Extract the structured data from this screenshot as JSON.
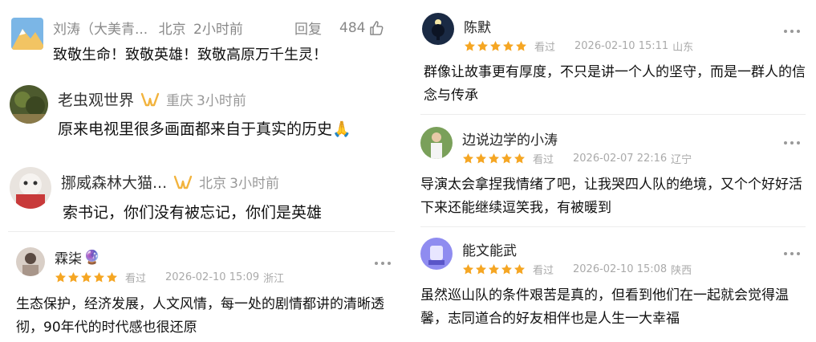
{
  "accent_colors": {
    "star": "#f5a623",
    "badge": "#f2b33d",
    "divider": "#ececec"
  },
  "left_column": {
    "comment1": {
      "username": "刘涛（大美青...",
      "location": "北京",
      "time": "2小时前",
      "reply_label": "回复",
      "likes": "484",
      "like_icon": "thumb-up-icon",
      "text": "致敬生命！致敬英雄！致敬高原万千生灵！"
    },
    "comment2": {
      "username": "老虫观世界",
      "badge_icon": "vip-badge-icon",
      "location": "重庆",
      "time": "3小时前",
      "text": "原来电视里很多画面都来自于真实的历史🙏"
    },
    "comment3": {
      "username": "挪威森林大猫...",
      "badge_icon": "vip-badge-icon",
      "location": "北京",
      "time": "3小时前",
      "text": "索书记，你们没有被忘记，你们是英雄"
    },
    "review1": {
      "username": "霖柒",
      "name_emoji": "🔮",
      "rating": 5,
      "seen_label": "看过",
      "datetime": "2026-02-10 15:09",
      "location": "浙江",
      "text": "生态保护，经济发展，人文风情，每一处的剧情都讲的清晰透彻，90年代的时代感也很还原"
    }
  },
  "right_column": {
    "reviews": [
      {
        "username": "陈默",
        "rating": 5,
        "seen_label": "看过",
        "datetime": "2026-02-10 15:11",
        "location": "山东",
        "text": "群像让故事更有厚度，不只是讲一个人的坚守，而是一群人的信念与传承"
      },
      {
        "username": "边说边学的小涛",
        "rating": 5,
        "seen_label": "看过",
        "datetime": "2026-02-07 22:16",
        "location": "辽宁",
        "text": "导演太会拿捏我情绪了吧，让我哭四人队的绝境，又个个好好活下来还能继续逗笑我，有被暖到"
      },
      {
        "username": "能文能武",
        "rating": 5,
        "seen_label": "看过",
        "datetime": "2026-02-10 15:08",
        "location": "陕西",
        "text": "虽然巡山队的条件艰苦是真的，但看到他们在一起就会觉得温馨，志同道合的好友相伴也是人生一大幸福"
      }
    ]
  }
}
